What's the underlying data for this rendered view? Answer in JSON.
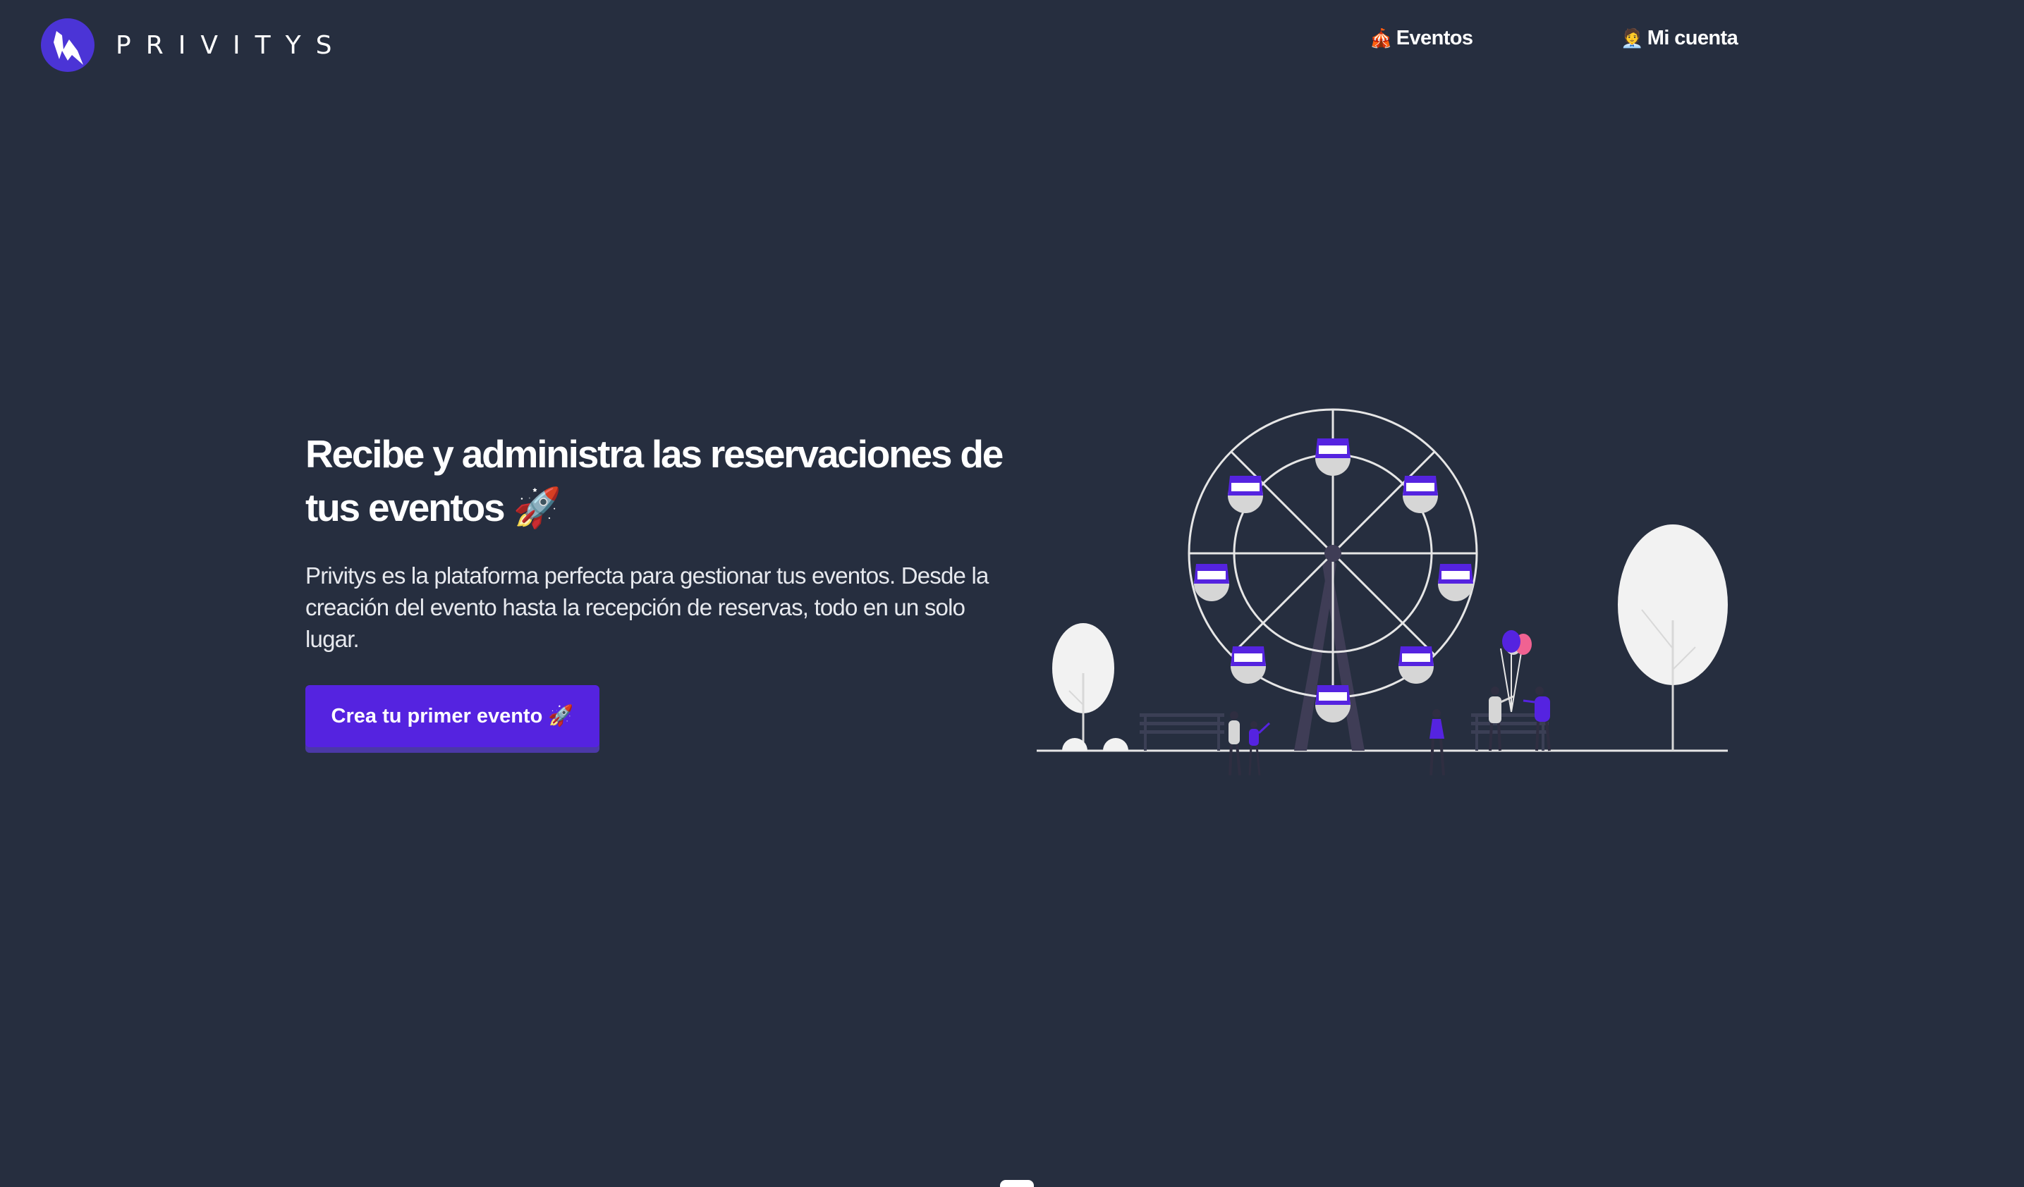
{
  "brand": {
    "name": "PRIVITYS",
    "logo_icon": "lightning-bolt-icon",
    "colors": {
      "accent": "#5523e0",
      "background": "#262e3f",
      "logo": "#4b34d6"
    }
  },
  "nav": {
    "events": {
      "emoji": "🎪",
      "label": "Eventos"
    },
    "account": {
      "emoji": "🧑‍💼",
      "label": "Mi cuenta"
    }
  },
  "hero": {
    "title": "Recibe y administra las reservaciones de tus eventos",
    "title_emoji": "🚀",
    "description": "Privitys es la plataforma perfecta para gestionar tus eventos. Desde la creación del evento hasta la recepción de reservas, todo en un solo lugar.",
    "cta_label": "Crea tu primer evento 🚀"
  }
}
